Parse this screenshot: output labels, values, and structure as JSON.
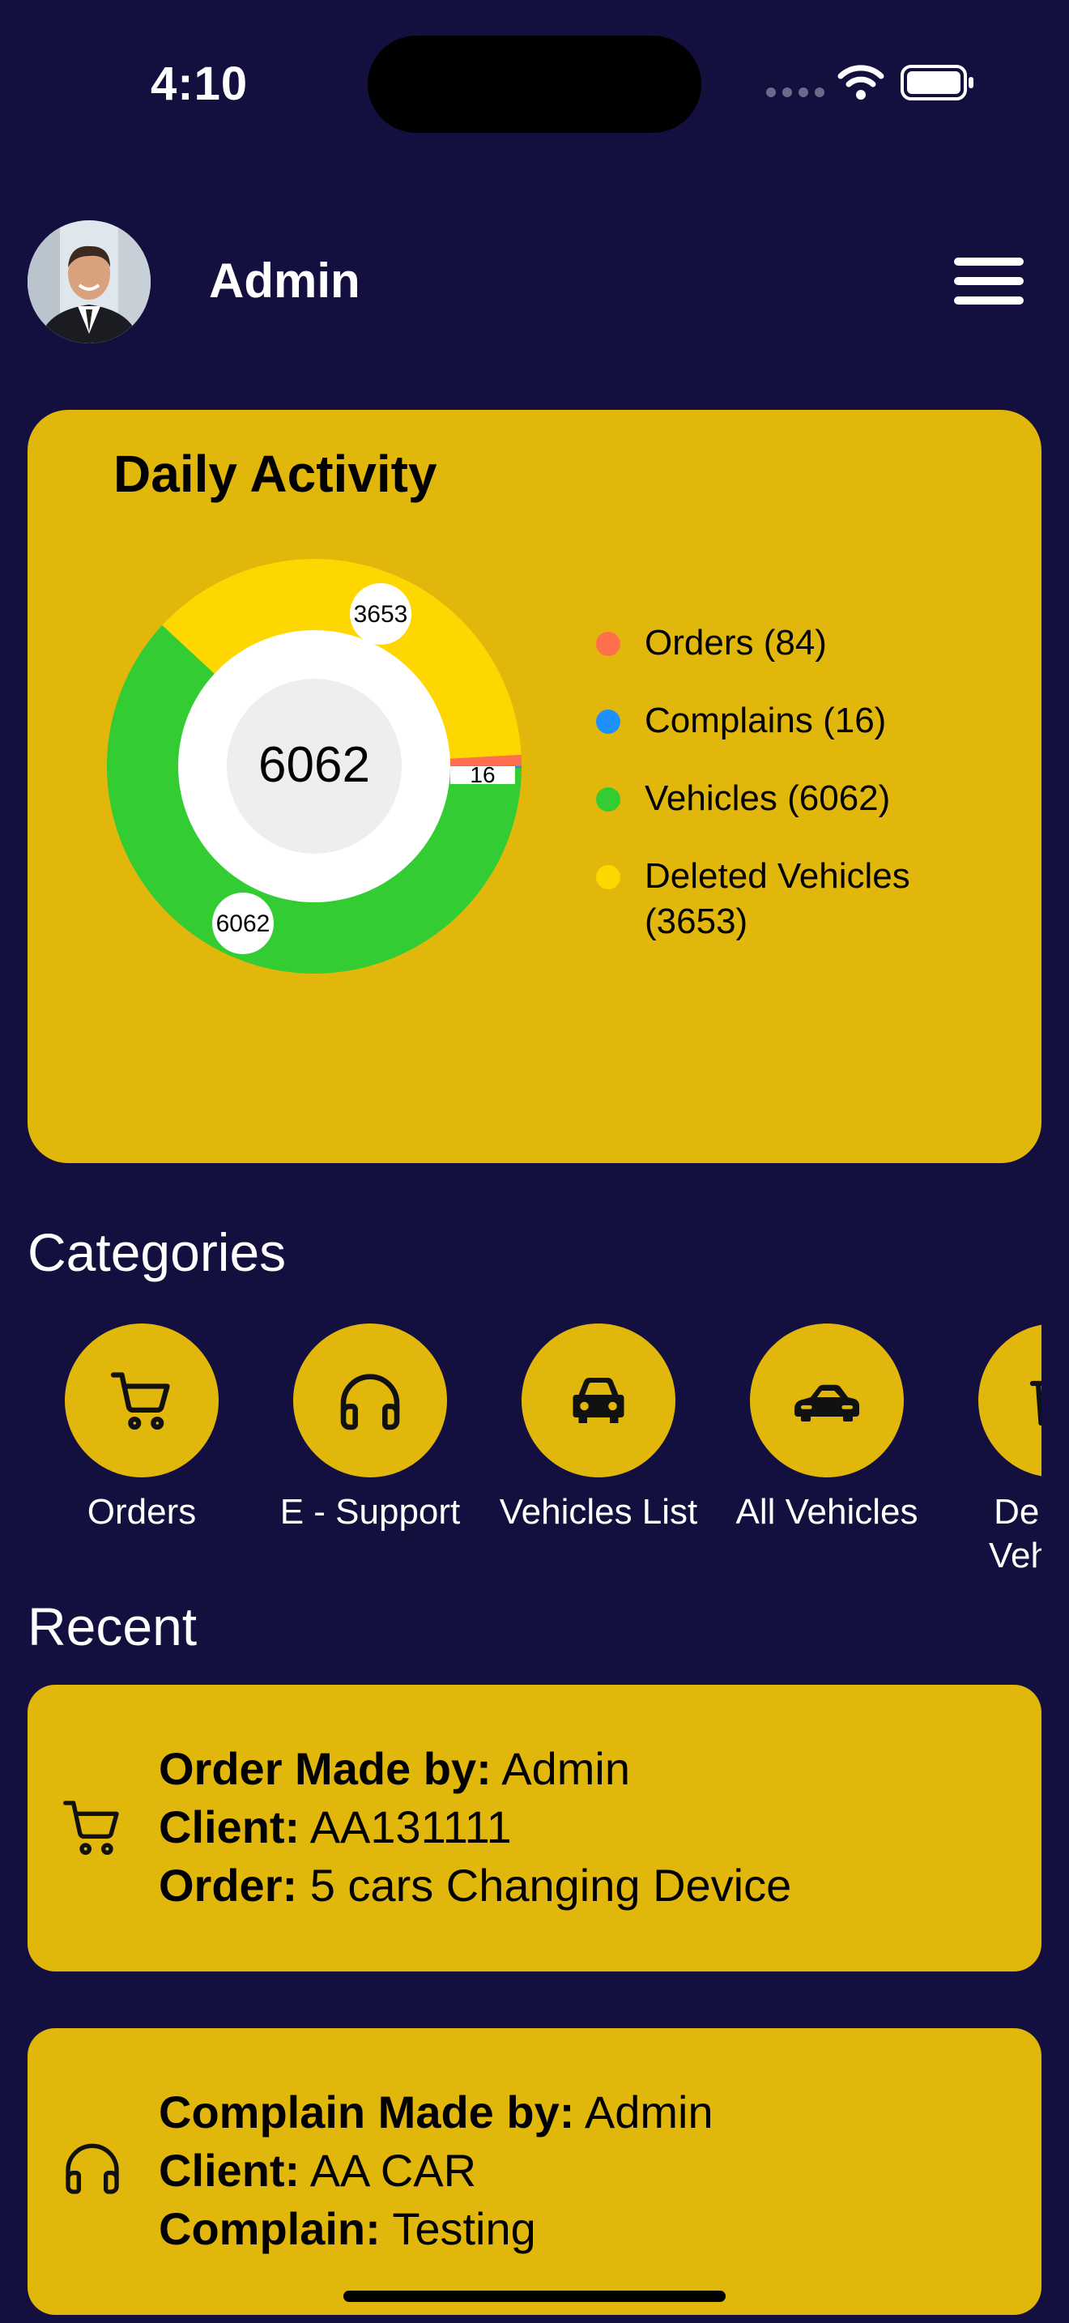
{
  "status_bar": {
    "time": "4:10"
  },
  "header": {
    "title": "Admin",
    "avatar_alt": "admin-avatar"
  },
  "activity": {
    "title": "Daily Activity",
    "center_value": "6062",
    "labels": {
      "deleted": "3653",
      "vehicles": "6062",
      "complains": "16"
    },
    "legend": [
      {
        "label": "Orders (84)",
        "color": "#ff6f4d"
      },
      {
        "label": "Complains (16)",
        "color": "#1e90ff"
      },
      {
        "label": "Vehicles (6062)",
        "color": "#33cc33"
      },
      {
        "label": "Deleted Vehicles (3653)",
        "color": "#ffd700"
      }
    ]
  },
  "chart_data": {
    "type": "pie",
    "categories": [
      "Orders",
      "Complains",
      "Vehicles",
      "Deleted Vehicles"
    ],
    "values": [
      84,
      16,
      6062,
      3653
    ],
    "colors": [
      "#ff6f4d",
      "#1e90ff",
      "#33cc33",
      "#ffd700"
    ],
    "title": "Daily Activity",
    "donut": true,
    "center_label": "6062"
  },
  "categories": {
    "title": "Categories",
    "items": [
      {
        "label": "Orders",
        "icon": "cart-icon"
      },
      {
        "label": "E - Support",
        "icon": "headphones-icon"
      },
      {
        "label": "Vehicles List",
        "icon": "car-front-icon"
      },
      {
        "label": "All Vehicles",
        "icon": "sports-car-icon"
      },
      {
        "label": "Deleted Vehicles",
        "icon": "trash-icon"
      }
    ]
  },
  "recent": {
    "title": "Recent",
    "items": [
      {
        "icon": "cart-icon",
        "lines": [
          {
            "key": "Order Made by:",
            "value": " Admin"
          },
          {
            "key": "Client:",
            "value": " AA131111"
          },
          {
            "key": "Order:",
            "value": " 5 cars Changing Device"
          }
        ]
      },
      {
        "icon": "headphones-icon",
        "lines": [
          {
            "key": "Complain Made by:",
            "value": " Admin"
          },
          {
            "key": "Client:",
            "value": " AA CAR"
          },
          {
            "key": "Complain:",
            "value": " Testing"
          }
        ]
      }
    ]
  }
}
